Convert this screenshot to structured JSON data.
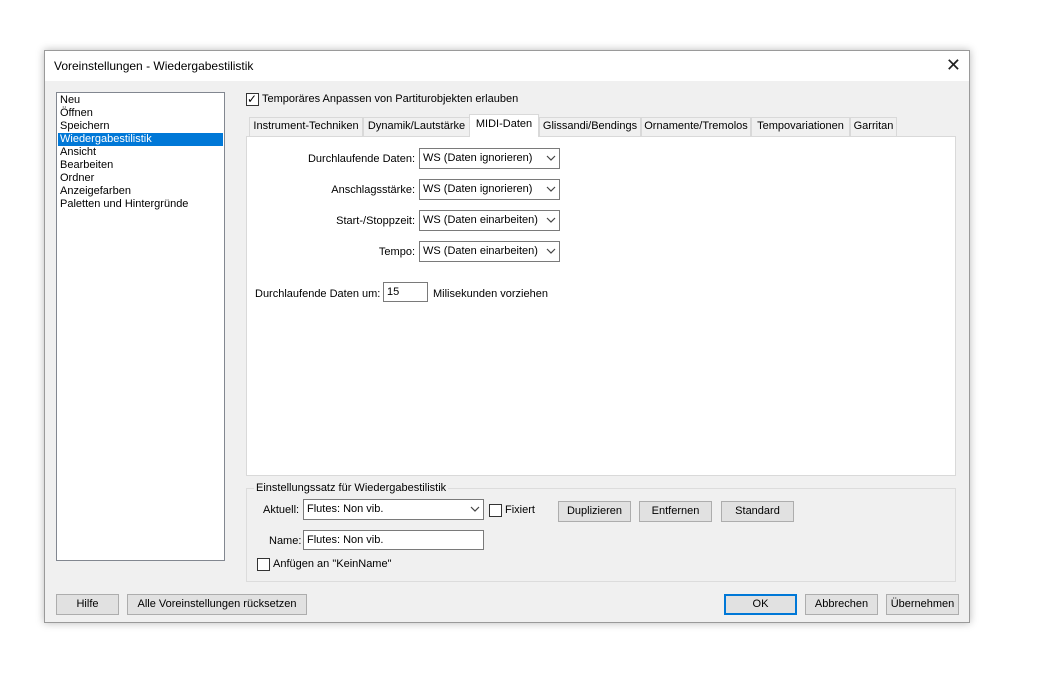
{
  "window": {
    "title": "Voreinstellungen - Wiedergabestilistik",
    "close_glyph": "✕"
  },
  "sidebar": {
    "items": [
      {
        "label": "Neu",
        "selected": false
      },
      {
        "label": "Öffnen",
        "selected": false
      },
      {
        "label": "Speichern",
        "selected": false
      },
      {
        "label": "Wiedergabestilistik",
        "selected": true
      },
      {
        "label": "Ansicht",
        "selected": false
      },
      {
        "label": "Bearbeiten",
        "selected": false
      },
      {
        "label": "Ordner",
        "selected": false
      },
      {
        "label": "Anzeigefarben",
        "selected": false
      },
      {
        "label": "Paletten und Hintergründe",
        "selected": false
      }
    ]
  },
  "top_checkbox": {
    "label": "Temporäres Anpassen von Partiturobjekten erlauben",
    "checked": true
  },
  "tabs": [
    {
      "label": "Instrument-Techniken",
      "active": false
    },
    {
      "label": "Dynamik/Lautstärke",
      "active": false
    },
    {
      "label": "MIDI-Daten",
      "active": true
    },
    {
      "label": "Glissandi/Bendings",
      "active": false
    },
    {
      "label": "Ornamente/Tremolos",
      "active": false
    },
    {
      "label": "Tempovariationen",
      "active": false
    },
    {
      "label": "Garritan",
      "active": false
    }
  ],
  "midi": {
    "rows": [
      {
        "label": "Durchlaufende Daten:",
        "value": "WS (Daten ignorieren)"
      },
      {
        "label": "Anschlagsstärke:",
        "value": "WS (Daten ignorieren)"
      },
      {
        "label": "Start-/Stoppzeit:",
        "value": "WS (Daten einarbeiten)"
      },
      {
        "label": "Tempo:",
        "value": "WS (Daten einarbeiten)"
      }
    ],
    "advance_label": "Durchlaufende Daten um:",
    "advance_value": "15",
    "advance_suffix": "Milisekunden vorziehen"
  },
  "preset": {
    "group_title": "Einstellungssatz für Wiedergabestilistik",
    "current_label": "Aktuell:",
    "current_value": "Flutes: Non vib.",
    "fixed_label": "Fixiert",
    "fixed_checked": false,
    "duplicate_label": "Duplizieren",
    "remove_label": "Entfernen",
    "standard_label": "Standard",
    "name_label": "Name:",
    "name_value": "Flutes: Non vib.",
    "append_label": "Anfügen an \"KeinName\"",
    "append_checked": false
  },
  "footer": {
    "help_label": "Hilfe",
    "reset_label": "Alle Voreinstellungen rücksetzen",
    "ok_label": "OK",
    "cancel_label": "Abbrechen",
    "apply_label": "Übernehmen"
  },
  "colors": {
    "dialog_bg": "#f0f0f0",
    "selection": "#0078d7",
    "panel_bg": "#ffffff"
  }
}
